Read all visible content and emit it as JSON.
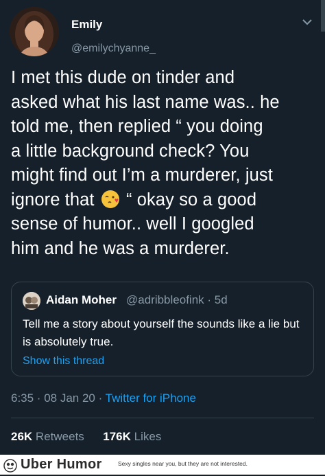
{
  "tweet": {
    "author_name": "Emily",
    "author_handle": "@emilychyanne_",
    "text_lines": [
      "I met this dude on tinder and",
      "asked what his last name was.. he",
      "told me, then replied “ you doing",
      "a little background check? You",
      "might find out I’m a murderer, just",
      "ignore that",
      " “ okay so a good",
      "sense of humor.. well I googled",
      "him and he was a murderer."
    ],
    "emoji": "face-blowing-kiss-icon"
  },
  "quote": {
    "author_name": "Aidan Moher",
    "author_handle": "@adribbleofink · 5d",
    "text": "Tell me a story about yourself the sounds like a lie but is absolutely true.",
    "show_thread": "Show this thread"
  },
  "meta": {
    "time_date": "6:35 · 08 Jan 20 · ",
    "source": "Twitter for iPhone"
  },
  "stats": {
    "retweets_count": "26K",
    "retweets_label": "Retweets",
    "likes_count": "176K",
    "likes_label": "Likes"
  },
  "footer": {
    "brand": "Uber Humor",
    "ad_text": "Sexy singles near you, but they are not interested."
  },
  "colors": {
    "background": "#15202b",
    "secondary_text": "#8899a6",
    "link": "#1da1f2",
    "border": "#38444d"
  }
}
